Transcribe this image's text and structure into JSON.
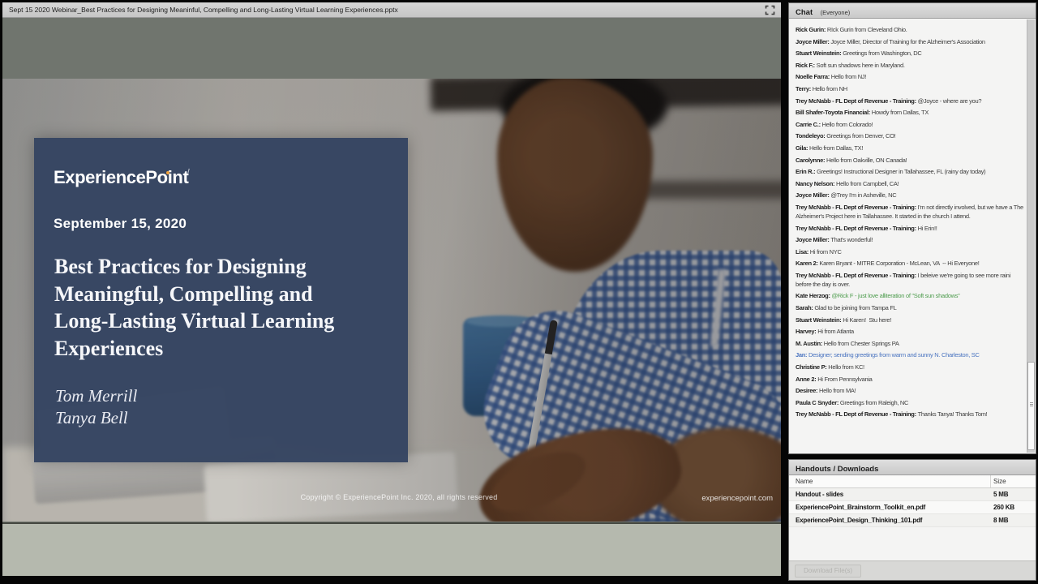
{
  "window": {
    "title": "Sept 15 2020 Webinar_Best Practices for Designing Meaninful, Compelling and Long-Lasting Virtual Learning Experiences.pptx"
  },
  "slide": {
    "logo": "ExperiencePoint",
    "logo_dot_color": "#f2a33c",
    "panel_color": "#354461",
    "date": "September 15, 2020",
    "title_lines": [
      "Best Practices for Designing",
      "Meaningful, Compelling and",
      "Long-Lasting Virtual Learning",
      "Experiences"
    ],
    "presenters": [
      "Tom Merrill",
      "Tanya Bell"
    ],
    "copyright": "Copyright © ExperiencePoint Inc. 2020, all rights reserved",
    "website": "experiencepoint.com"
  },
  "chat": {
    "title": "Chat",
    "scope": "(Everyone)",
    "text_colors": {
      "green": "#4f9d4f",
      "blue": "#4a74c0"
    },
    "messages": [
      {
        "name": "Rick Gurin",
        "text": "RIck Gurin from Cleveland Ohio."
      },
      {
        "name": "Joyce Miller",
        "text": "Joyce Miller, Director of Training for the Alzheimer's Association"
      },
      {
        "name": "Stuart Weinstein",
        "text": "Greetings from Washington, DC"
      },
      {
        "name": "Rick F.",
        "text": "Soft sun shadows here in Maryland."
      },
      {
        "name": "Noelle Farra",
        "text": "Hello from NJ!"
      },
      {
        "name": "Terry",
        "text": "Hello from NH"
      },
      {
        "name": "Trey McNabb - FL Dept of Revenue - Training",
        "text": "@Joyce - where are you?"
      },
      {
        "name": "Bill Shafer-Toyota Financial",
        "text": "Howdy from Dallas, TX"
      },
      {
        "name": "Carrie C.",
        "text": "Hello from Colorado!"
      },
      {
        "name": "Tondeleyo",
        "text": "Greetings from Denver, CO!"
      },
      {
        "name": "Gila",
        "text": "Hello from Dallas, TX!"
      },
      {
        "name": "Carolynne",
        "text": "Hello from Oakville, ON Canada!"
      },
      {
        "name": "Erin R.",
        "text": "Greetings! Instructional Designer in Tallahassee, FL (rainy day today)"
      },
      {
        "name": "Nancy Nelson",
        "text": "Hello from Campbell, CA!"
      },
      {
        "name": "Joyce Miller",
        "text": "@Trey I'm in Asheville, NC"
      },
      {
        "name": "Trey McNabb - FL Dept of Revenue - Training",
        "text": "I'm not directly involved, but we have a The Alzheimer's Project here in Tallahassee. It started in the church I attend."
      },
      {
        "name": "Trey McNabb - FL Dept of Revenue - Training",
        "text": "Hi Erin!!"
      },
      {
        "name": "Joyce Miller",
        "text": "That's wonderful!"
      },
      {
        "name": "Lisa",
        "text": "Hi from NYC"
      },
      {
        "name": "Karen 2",
        "text": "Karen Bryant - MITRE Corporation - McLean, VA  -- Hi Everyone!"
      },
      {
        "name": "Trey McNabb - FL Dept of Revenue - Training",
        "text": "I beleive we're going to see more raini before the day is over."
      },
      {
        "name": "Kate Herzog",
        "text": "@Rick F - just love alliteration of \"Soft sun shadows\"",
        "color": "green"
      },
      {
        "name": "Sarah",
        "text": "Glad to be joining from Tampa FL"
      },
      {
        "name": "Stuart Weinstein",
        "text": "Hi Karen!  Stu here!"
      },
      {
        "name": "Harvey",
        "text": "Hi from Atlanta"
      },
      {
        "name": "M. Austin",
        "text": "Hello from Chester Springs PA"
      },
      {
        "name": "Jan",
        "text": "Designer; sending greetings from warm and sunny N. Charleston, SC",
        "color": "blue",
        "color_name": true
      },
      {
        "name": "Christine P",
        "text": "Hello from KC!"
      },
      {
        "name": "Anne 2",
        "text": "Hi From Pennsylvania"
      },
      {
        "name": "Desiree",
        "text": "Hello from MA!"
      },
      {
        "name": "Paula C Snyder",
        "text": "Greetings from Raleigh, NC"
      },
      {
        "name": "Trey McNabb - FL Dept of Revenue - Training",
        "text": "Thanks Tanya! Thanks Tom!"
      }
    ]
  },
  "handouts": {
    "title": "Handouts / Downloads",
    "columns": [
      "Name",
      "Size"
    ],
    "files": [
      {
        "name": "Handout - slides",
        "size": "5 MB"
      },
      {
        "name": "ExperiencePoint_Brainstorm_Toolkit_en.pdf",
        "size": "260 KB"
      },
      {
        "name": "ExperiencePoint_Design_Thinking_101.pdf",
        "size": "8 MB"
      }
    ],
    "download_button": "Download File(s)"
  }
}
